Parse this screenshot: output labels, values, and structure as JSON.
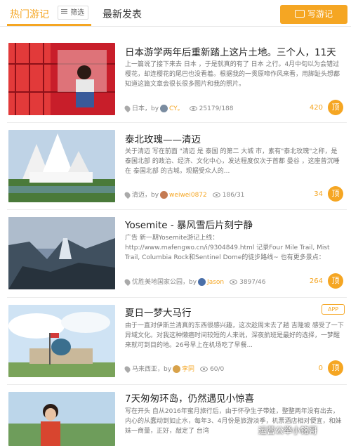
{
  "tabs": {
    "hot": "热门游记",
    "filter": "筛选",
    "latest": "最新发表",
    "write": "写游记"
  },
  "posts": [
    {
      "title": "日本游学两年后重新踏上这片土地。三个人，11天...",
      "excerpt": "上一篇说了接下来去 日本 ，于是就真的有了 日本 之行。4月中旬以为会错过樱花，却连樱花的尾巴也没看着。根据我的一贯原啼作风来看，用脚趾头想都知道这篇文章会很长很多图片和我的照片。",
      "location": "日本，by",
      "user": "CY。",
      "stats": "25179/188",
      "likes": "420",
      "ding": "顶"
    },
    {
      "title": "泰北玫瑰——清迈",
      "excerpt": "关于清迈 写在前面 \"清迈 是 泰国 的第二 大城 市，素有\"泰北玫瑰\"之称，是 泰国北部 的政治、经济、文化中心，发达程度仅次于首都 曼谷 ，这座曾沉睡在 泰国北部 的古城，现据受众人的...",
      "location": "清迈，by",
      "user": "weiwei0872",
      "stats": "186/31",
      "likes": "34",
      "ding": "顶"
    },
    {
      "title": "Yosemite - 暴风雪后片刻宁静",
      "excerpt": "广告 新一期Yosemite游记上线：http://www.mafengwo.cn/i/9304849.html 记录Four Mile Trail, Mist Trail, Columbia Rock和Sentinel Dome的徒步路线~ 也有更多景点：Glacier Point, Vernal...",
      "location": "优胜美地国家公园，by",
      "user": "Jason",
      "stats": "3897/46",
      "likes": "264",
      "ding": "顶"
    },
    {
      "title": "夏日一梦大马行",
      "excerpt": "由于一直对伊斯兰清真的东西很感兴趣，这次趁周末去了趟 吉隆坡 感受了一下异域文化。对我这种懒癌时间较短的人来说，深夜航班是最好的选择，一梦醒来就可到目的地。26号早上在机场吃了早餐...",
      "location": "马来西亚，by",
      "user": "李同",
      "stats": "60/0",
      "likes": "0",
      "ding": "顶",
      "badge": "APP"
    },
    {
      "title": "7天匆匆环岛，仍然遇见小惊喜",
      "excerpt": "写在开头 自从2016年蜜月旅行后，由于怀孕生子带娃，整整两年没有出去，内心的从蠢动到如止水，每年3、4月份是旅游淡季，机票酒店相对便宜，和妹妹一商量，正好，敲定了 台湾 ",
      "location": "",
      "user": "",
      "stats": "",
      "likes": "",
      "ding": ""
    }
  ],
  "watermark": "运营公举小铭哥",
  "colors": {
    "accent": "#f5a623",
    "text": "#222222",
    "muted": "#777777"
  }
}
